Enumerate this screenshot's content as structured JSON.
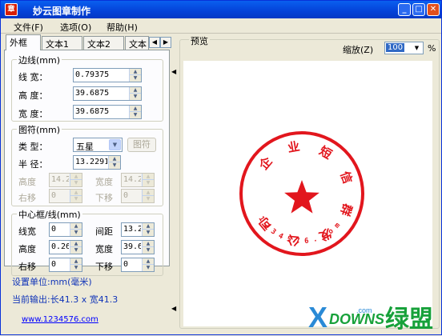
{
  "window": {
    "title": "妙云图章制作",
    "app_icon_text": "章"
  },
  "menu": [
    "文件(F)",
    "选项(O)",
    "帮助(H)"
  ],
  "tabs": [
    "外框",
    "文本1",
    "文本2",
    "文本"
  ],
  "border_group": {
    "title": "边线(mm)",
    "line_width_label": "线  宽：",
    "line_width": "0.79375",
    "height_label": "高  度：",
    "height": "39.6875",
    "width_label": "宽  度：",
    "width": "39.6875"
  },
  "symbol_group": {
    "title": "图符(mm)",
    "type_label": "类  型：",
    "type_value": "五星",
    "symbol_button": "图符",
    "radius_label": "半  径：",
    "radius": "13.2291",
    "height_label": "高度",
    "height": "14.2",
    "width_label": "宽度",
    "width": "14.2",
    "right_label": "右移",
    "right": "0",
    "down_label": "下移",
    "down": "0"
  },
  "center_group": {
    "title": "中心框/线(mm)",
    "line_width_label": "线宽",
    "line_width": "0",
    "spacing_label": "间距",
    "spacing": "13.2",
    "height_label": "高度",
    "height": "0.26",
    "width_label": "宽度",
    "width": "39.6",
    "right_label": "右移",
    "right": "0",
    "down_label": "下移",
    "down": "0"
  },
  "status": {
    "unit_text": "设置单位:mm(毫米)",
    "output_text": "当前输出:长41.3 x 宽41.3",
    "link": "www.1234576.com"
  },
  "preview": {
    "title": "预览",
    "zoom_label": "缩放(Z)",
    "zoom_value": "100",
    "percent": "%"
  },
  "stamp": {
    "top_text": [
      "企",
      "业",
      "短",
      "信",
      "群",
      "发",
      "公",
      "司"
    ],
    "bottom_text": "1234576.com",
    "color": "#e2161d"
  },
  "watermark": {
    "brand": "DOWNS",
    "cn": "绿盟",
    "dot_com": ".com",
    "x_color": "#2a8ad6",
    "cn_color": "#17a13a"
  }
}
